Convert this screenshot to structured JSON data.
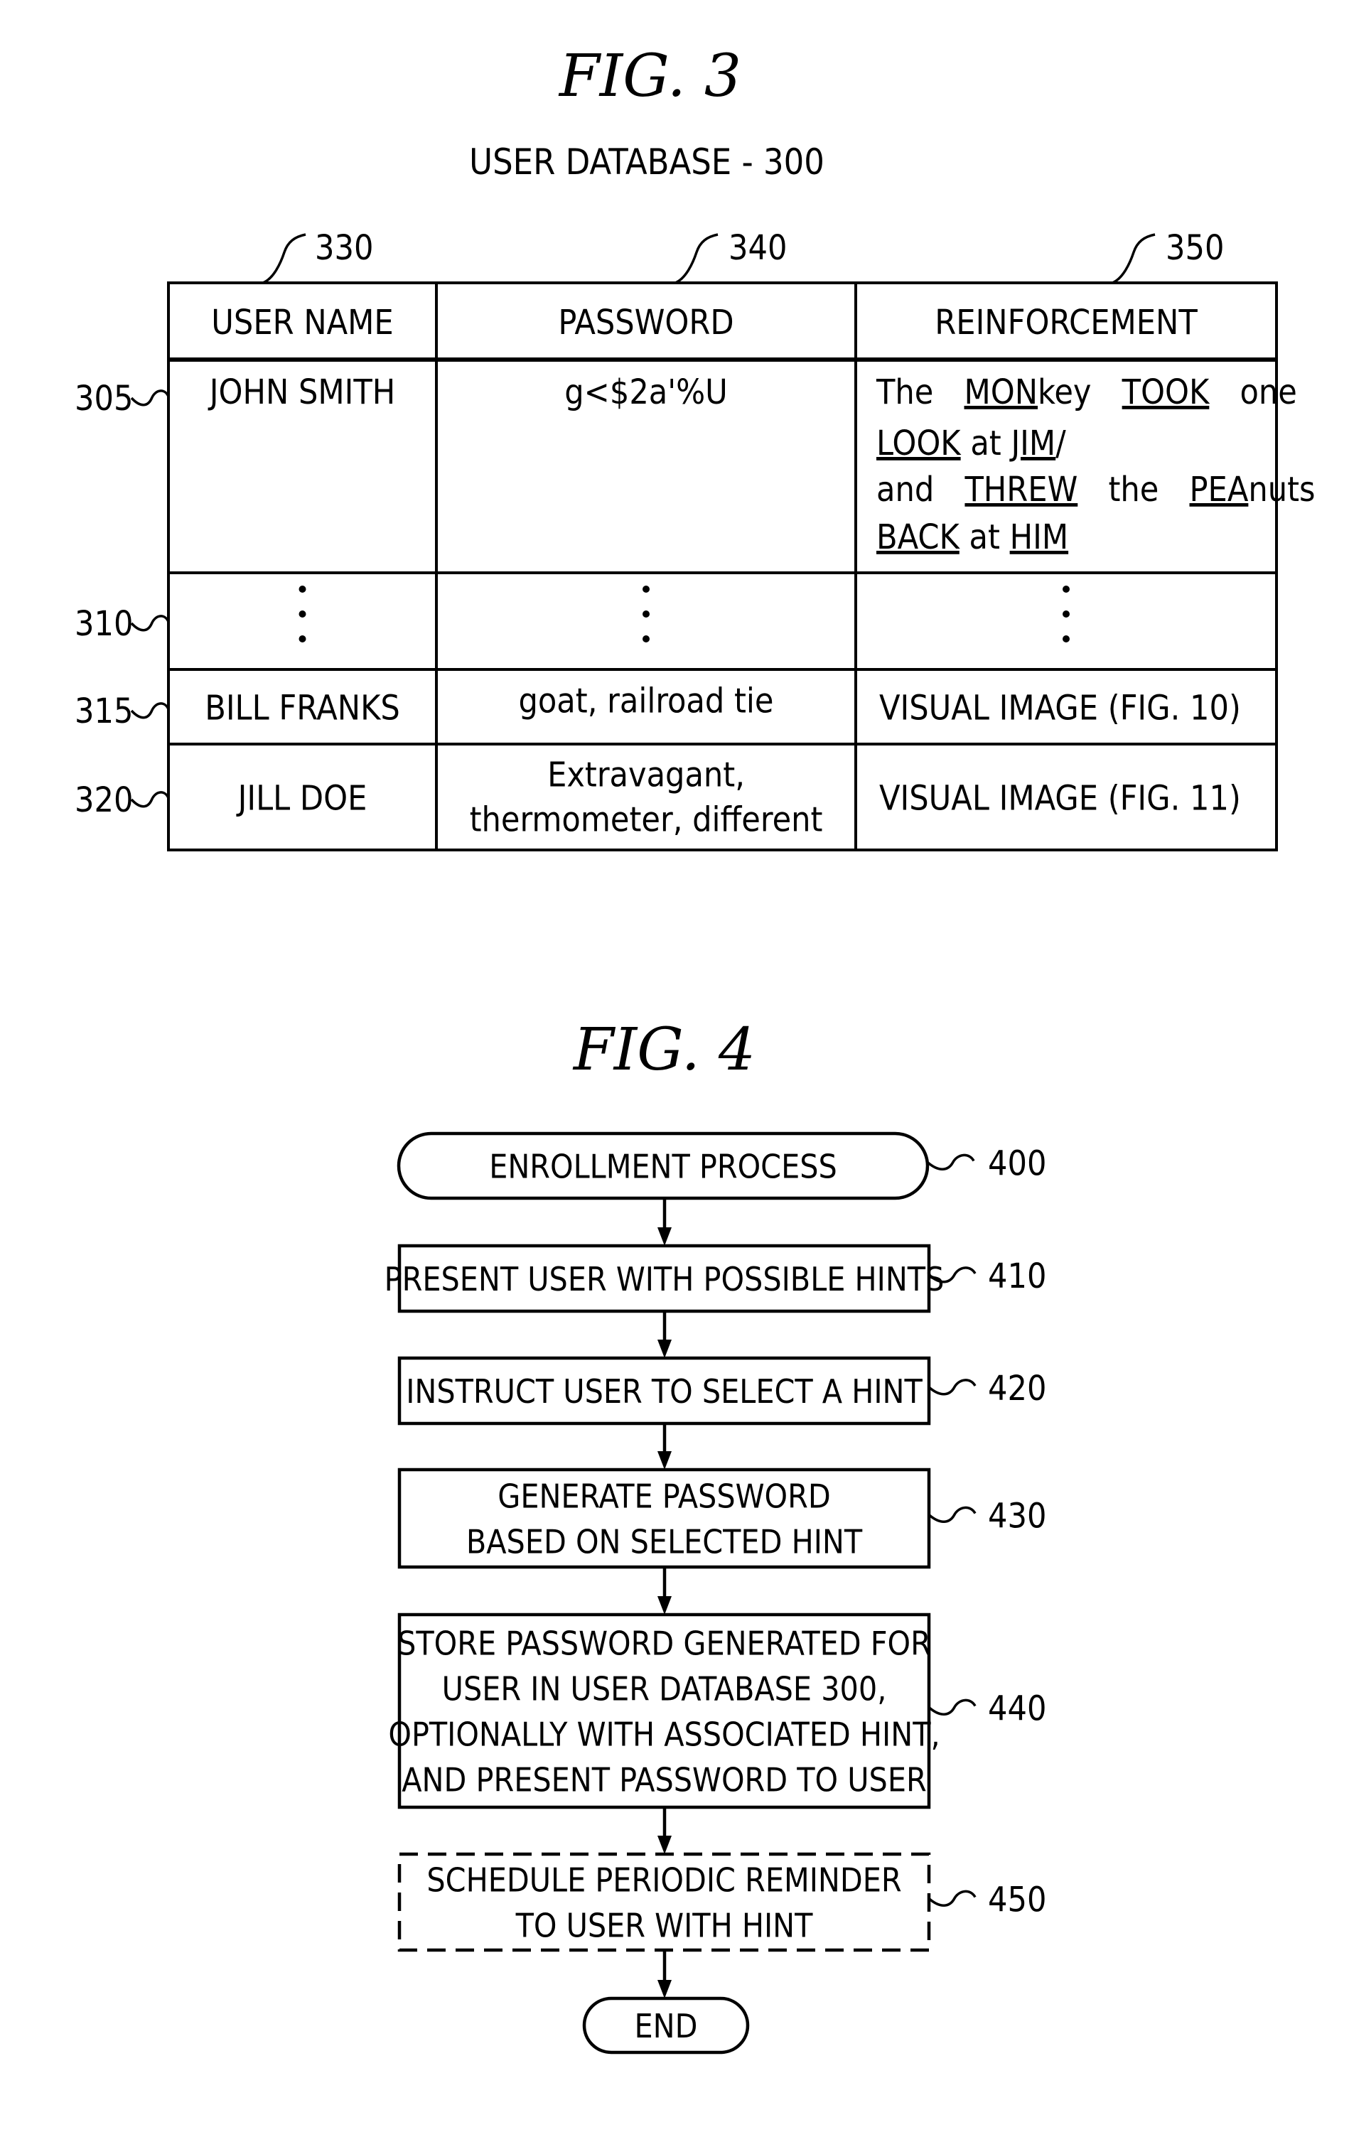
{
  "figure3": {
    "title": "FIG. 3",
    "subtitle": "USER DATABASE - 300",
    "column_refs": [
      "330",
      "340",
      "350"
    ],
    "columns": [
      "USER NAME",
      "PASSWORD",
      "REINFORCEMENT"
    ],
    "rows": [
      {
        "ref": "305",
        "user_name": "JOHN SMITH",
        "password": [
          "g<$2a'%U"
        ],
        "reinforcement_lines": [
          [
            {
              "t": "The",
              "u": false
            },
            {
              "t": "MON",
              "u": true
            },
            {
              "t": "key",
              "u": false
            },
            {
              "t": "TOOK",
              "u": true
            },
            {
              "t": "one",
              "u": false
            }
          ],
          [
            {
              "t": "LOOK",
              "u": true
            },
            {
              "t": "at",
              "u": false
            },
            {
              "t": "JIM",
              "u": true
            },
            {
              "t": "/",
              "u": false
            }
          ],
          [
            {
              "t": "and",
              "u": false
            },
            {
              "t": "THREW",
              "u": true
            },
            {
              "t": "the",
              "u": false
            },
            {
              "t": "PEA",
              "u": true
            },
            {
              "t": "nuts",
              "u": false
            }
          ],
          [
            {
              "t": "BACK",
              "u": true
            },
            {
              "t": "at",
              "u": false
            },
            {
              "t": "HIM",
              "u": true
            }
          ]
        ]
      },
      {
        "ref": "310",
        "user_name": "⋮",
        "password": [
          "⋮"
        ],
        "reinforcement": "⋮"
      },
      {
        "ref": "315",
        "user_name": "BILL FRANKS",
        "password": [
          "goat, railroad tie"
        ],
        "reinforcement": "VISUAL IMAGE (FIG. 10)"
      },
      {
        "ref": "320",
        "user_name": "JILL DOE",
        "password": [
          "Extravagant,",
          "thermometer, different"
        ],
        "reinforcement": "VISUAL IMAGE (FIG. 11)"
      }
    ]
  },
  "figure4": {
    "title": "FIG. 4",
    "steps": [
      {
        "ref": "400",
        "shape": "terminal",
        "lines": [
          "ENROLLMENT PROCESS"
        ]
      },
      {
        "ref": "410",
        "shape": "process",
        "lines": [
          "PRESENT USER WITH POSSIBLE HINTS"
        ]
      },
      {
        "ref": "420",
        "shape": "process",
        "lines": [
          "INSTRUCT USER TO SELECT A HINT"
        ]
      },
      {
        "ref": "430",
        "shape": "process",
        "lines": [
          "GENERATE PASSWORD",
          "BASED ON SELECTED HINT"
        ]
      },
      {
        "ref": "440",
        "shape": "process",
        "lines": [
          "STORE PASSWORD GENERATED FOR",
          "USER IN USER DATABASE 300,",
          "OPTIONALLY WITH ASSOCIATED HINT,",
          "AND PRESENT PASSWORD TO USER"
        ]
      },
      {
        "ref": "450",
        "shape": "optional",
        "lines": [
          "SCHEDULE PERIODIC REMINDER",
          "TO USER WITH HINT"
        ]
      },
      {
        "ref": "",
        "shape": "terminal",
        "lines": [
          "END"
        ]
      }
    ]
  }
}
